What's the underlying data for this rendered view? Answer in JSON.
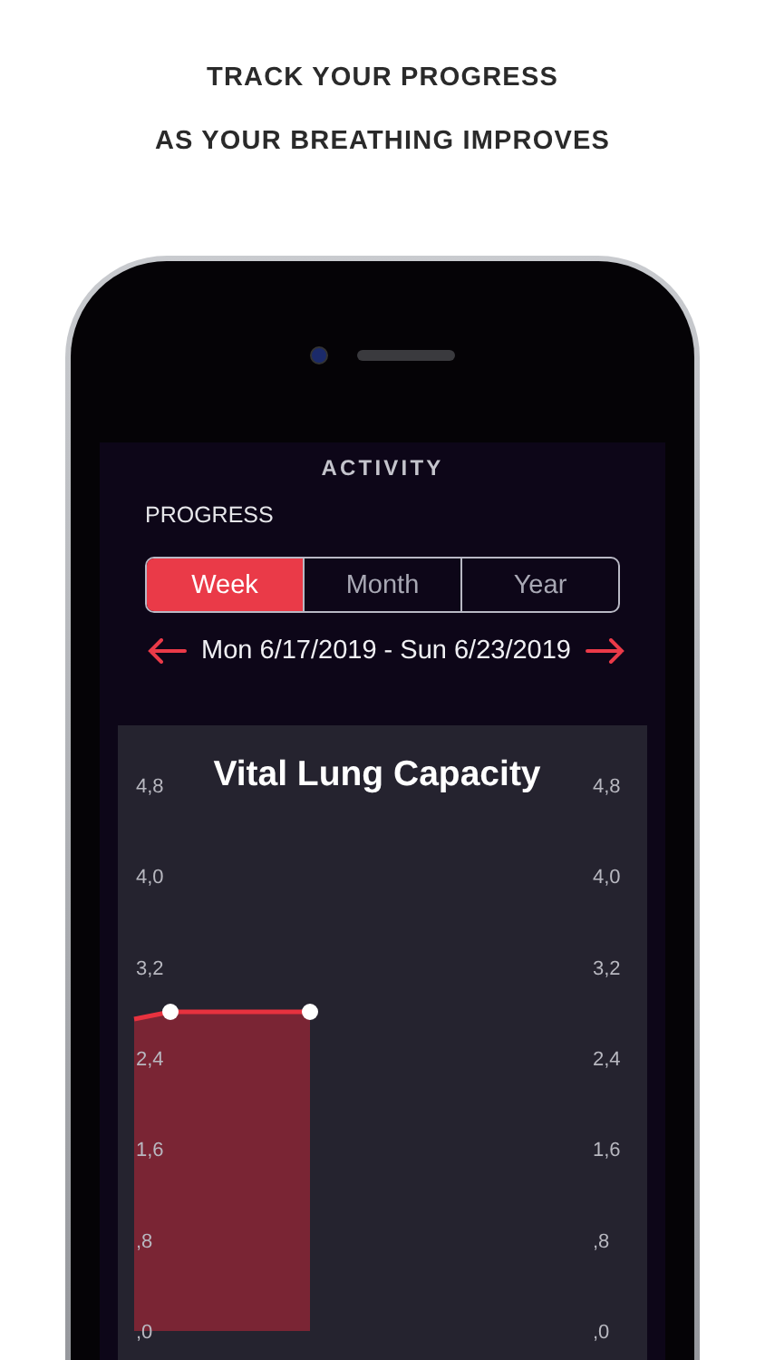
{
  "headline": [
    "TRACK YOUR PROGRESS",
    "AS YOUR BREATHING IMPROVES"
  ],
  "screen": {
    "title": "ACTIVITY",
    "section": "PROGRESS",
    "tabs": [
      {
        "label": "Week",
        "selected": true
      },
      {
        "label": "Month",
        "selected": false
      },
      {
        "label": "Year",
        "selected": false
      }
    ],
    "date_range": "Mon 6/17/2019 - Sun 6/23/2019",
    "chart": {
      "title": "Vital Lung Capacity",
      "left_axis_labels": [
        "4,8",
        "4,0",
        "3,2",
        "2,4",
        "1,6",
        ",8",
        ",0"
      ],
      "right_axis_labels": [
        "4,8",
        "4,0",
        "3,2",
        "2,4",
        "1,6",
        ",8",
        ",0"
      ]
    }
  }
}
